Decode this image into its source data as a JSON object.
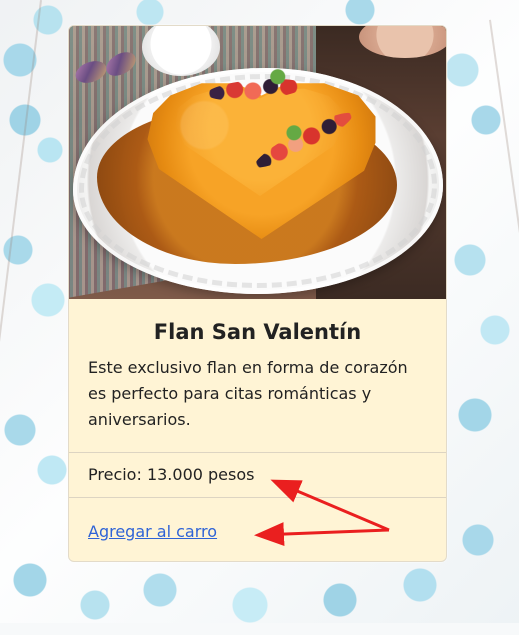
{
  "product": {
    "title": "Flan San Valentín",
    "description": "Este exclusivo flan en forma de corazón es perfecto para citas románticas y aniversarios.",
    "price": "Precio: 13.000 pesos",
    "cart_link": "Agregar al carro"
  },
  "icons": {
    "annotation_arrow_1": "red-arrow-icon",
    "annotation_arrow_2": "red-arrow-icon"
  },
  "colors": {
    "card_background": "#fff4d5",
    "link": "#2f63d6",
    "annotation": "#ea1f1f"
  }
}
